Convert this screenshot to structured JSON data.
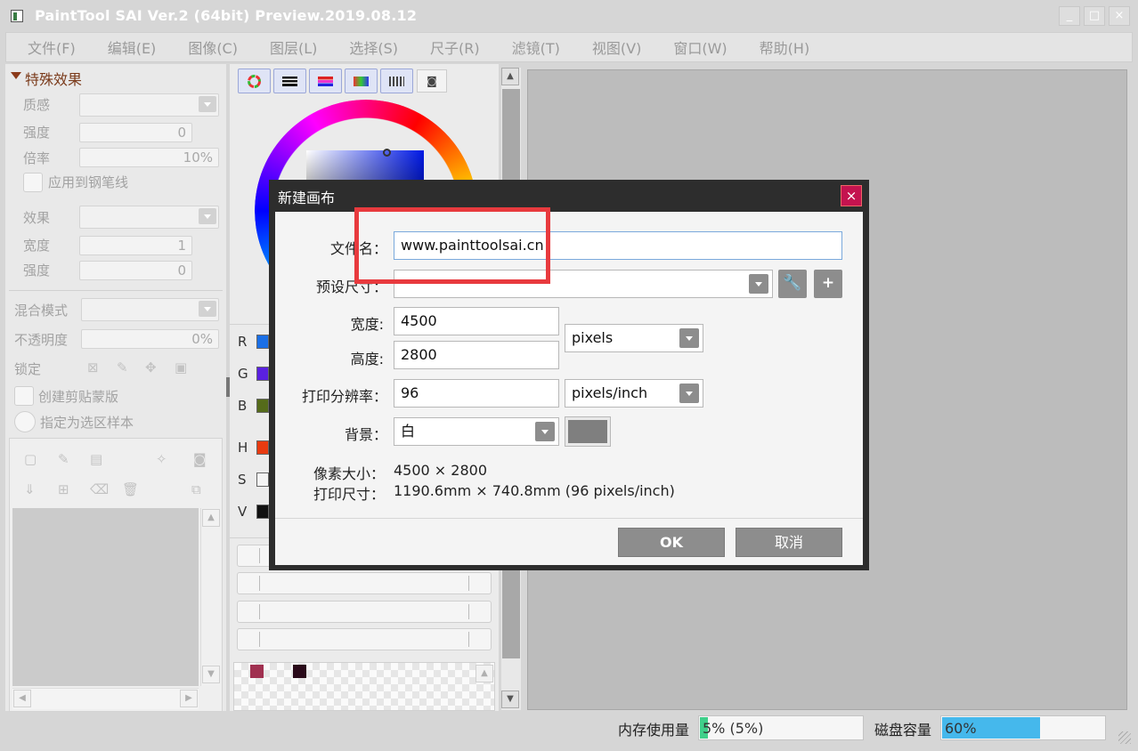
{
  "window": {
    "title": "PaintTool SAI Ver.2 (64bit) Preview.2019.08.12",
    "minimize_glyph": "_",
    "maximize_glyph": "□",
    "close_glyph": "×"
  },
  "menu": {
    "items": [
      "文件(F)",
      "编辑(E)",
      "图像(C)",
      "图层(L)",
      "选择(S)",
      "尺子(R)",
      "滤镜(T)",
      "视图(V)",
      "窗口(W)",
      "帮助(H)"
    ]
  },
  "effects_panel": {
    "header": "特殊效果",
    "texture_label": "质感",
    "strength_label": "强度",
    "strength_value": "0",
    "scale_label": "倍率",
    "scale_value": "10%",
    "apply_pen_label": "应用到钢笔线",
    "effect_label": "效果",
    "width_label": "宽度",
    "width_value": "1",
    "strength2_label": "强度",
    "strength2_value": "0"
  },
  "layer_panel": {
    "blend_mode_label": "混合模式",
    "opacity_label": "不透明度",
    "opacity_value": "0%",
    "lock_label": "锁定",
    "clip_label": "创建剪贴蒙版",
    "sample_label": "指定为选区样本"
  },
  "color_panel": {
    "channels": [
      "R",
      "G",
      "B",
      "H",
      "S",
      "V"
    ],
    "channel_colors": [
      "#1a6fe6",
      "#5a20e0",
      "#556b1a",
      "#e83a10",
      "#f4f4f4",
      "#111111"
    ],
    "swatches": [
      "#a03050",
      "#2a0a1a"
    ]
  },
  "dialog": {
    "title": "新建画布",
    "close_glyph": "×",
    "filename_label": "文件名：",
    "filename_value": "www.painttoolsai.cn",
    "preset_label": "预设尺寸：",
    "preset_value": "",
    "width_label": "宽度:",
    "width_value": "4500",
    "height_label": "高度:",
    "height_value": "2800",
    "unit_value": "pixels",
    "dpi_label": "打印分辨率：",
    "dpi_value": "96",
    "dpi_unit_value": "pixels/inch",
    "bg_label": "背景：",
    "bg_value": "白",
    "bg_color": "#7f7f7f",
    "pixel_size_label": "像素大小：",
    "pixel_size_value": "4500 × 2800",
    "print_size_label": "打印尺寸：",
    "print_size_value": "1190.6mm × 740.8mm (96 pixels/inch)",
    "ok_label": "OK",
    "cancel_label": "取消"
  },
  "status": {
    "memory_label": "内存使用量",
    "memory_value": "5% (5%)",
    "memory_fraction": 0.05,
    "disk_label": "磁盘容量",
    "disk_value": "60%",
    "disk_fraction": 0.6,
    "memory_color": "#3fcf8a",
    "disk_color": "#45b8ec"
  }
}
